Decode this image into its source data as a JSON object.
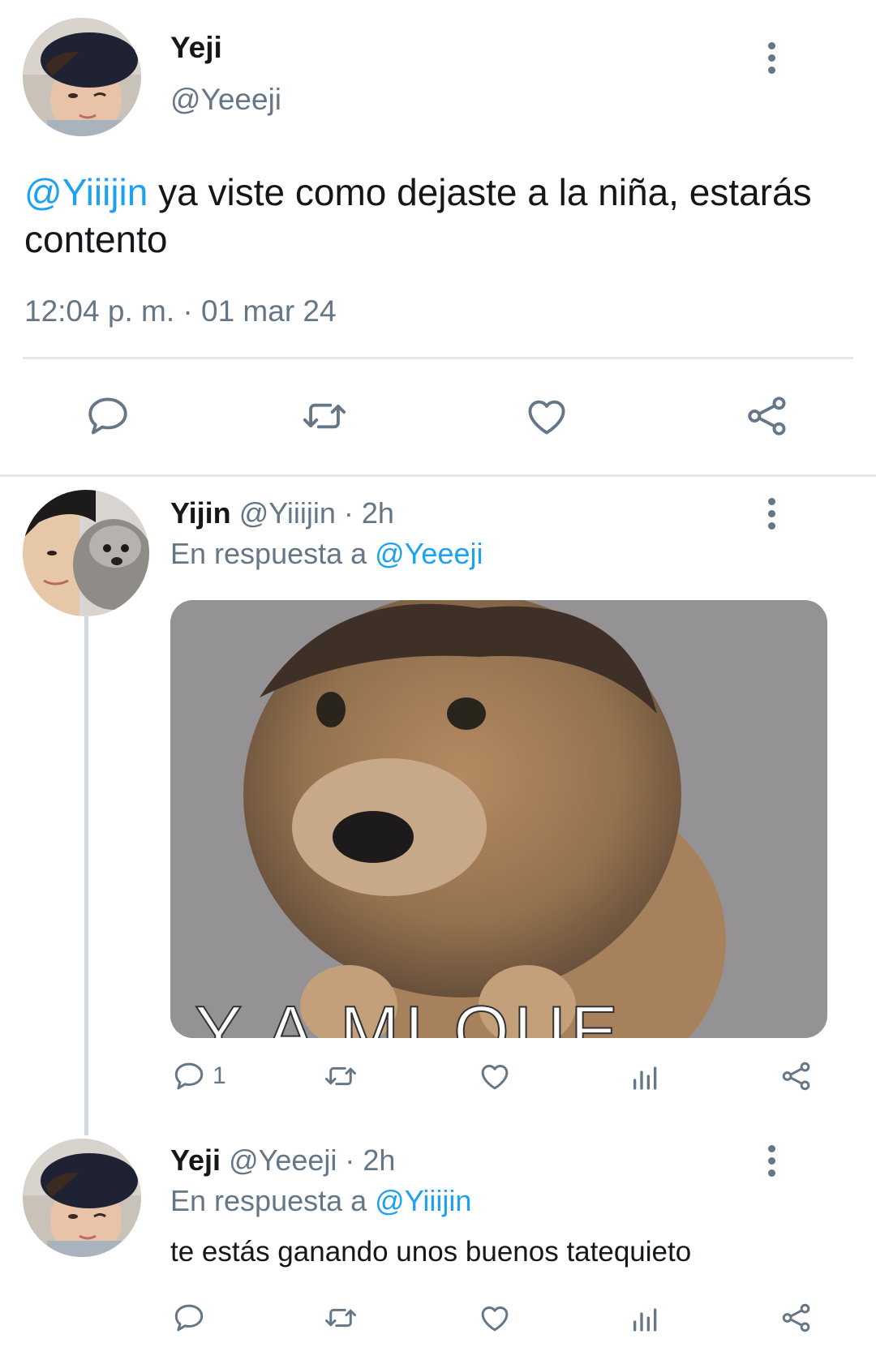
{
  "main_tweet": {
    "name": "Yeji",
    "handle": "@Yeeeji",
    "mention": "@Yiiijin",
    "text": " ya viste como dejaste a la niña, estarás contento",
    "time": "12:04 p. m. · 01 mar 24"
  },
  "reply1": {
    "name": "Yijin",
    "meta": "@Yiiijin · 2h",
    "reply_prefix": "En respuesta a ",
    "reply_to": "@Yeeeji",
    "image_caption": "Y A MI QUE",
    "reply_count": "1"
  },
  "reply2": {
    "name": "Yeji",
    "meta": "@Yeeeji · 2h",
    "reply_prefix": "En respuesta a ",
    "reply_to": "@Yiiijin",
    "text": "te estás ganando unos buenos tatequieto"
  },
  "icons": [
    "reply-icon",
    "retweet-icon",
    "like-icon",
    "views-icon",
    "share-icon",
    "more-options-icon"
  ],
  "colors": {
    "link": "#1da1f2",
    "muted": "#657786",
    "separator": "#e1e8ed"
  }
}
